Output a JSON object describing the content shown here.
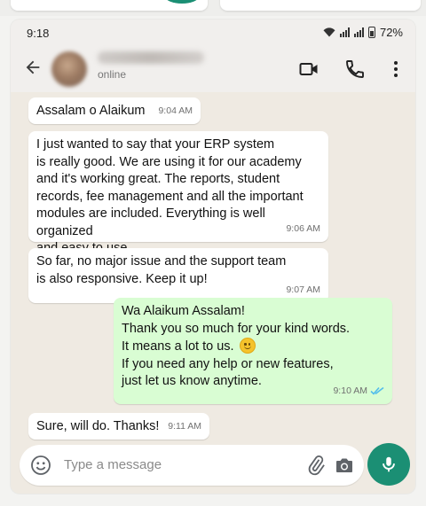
{
  "status_bar": {
    "time": "9:18",
    "battery": "72%"
  },
  "header": {
    "contact_status": "online"
  },
  "messages": [
    {
      "dir": "in",
      "text": "Assalam o Alaikum",
      "time": "9:04 AM"
    },
    {
      "dir": "in",
      "text": "I just wanted to say that your ERP system\nis really good. We are using it for our academy\nand it's working great. The reports, student\nrecords, fee management and all the important\nmodules are included. Everything is well organized\nand easy to use.",
      "time": "9:06 AM"
    },
    {
      "dir": "in",
      "text": "So far, no major issue and the support team\nis also responsive. Keep it up!",
      "time": "9:07 AM"
    },
    {
      "dir": "out",
      "line1": "Wa Alaikum Assalam!",
      "line2": "Thank you so much for your kind words.",
      "line3": "It means a lot to us.",
      "line4": "If you need any help or new features,",
      "line5": "just let us know anytime.",
      "time": "9:10 AM",
      "emoji": "smiling-face"
    },
    {
      "dir": "in",
      "text": "Sure, will do. Thanks!",
      "time": "9:11 AM"
    }
  ],
  "composer": {
    "placeholder": "Type a message"
  },
  "colors": {
    "accent": "#1b8f74",
    "outgoing_bubble": "#d9fdd3",
    "chat_background": "#efeae2",
    "read_ticks": "#53bdeb"
  }
}
